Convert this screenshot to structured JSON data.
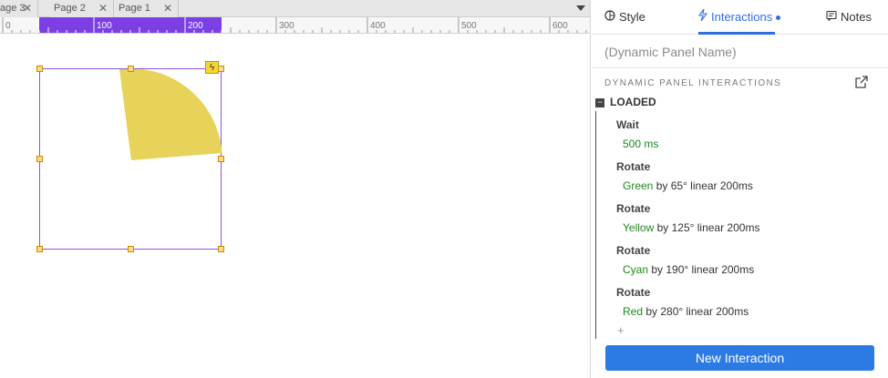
{
  "page_tabs": [
    {
      "label": "age 3",
      "close": "✕"
    },
    {
      "label": "Page 2",
      "close": "✕"
    },
    {
      "label": "Page 1",
      "close": "✕"
    }
  ],
  "ruler": {
    "labels": [
      "0",
      "100",
      "200",
      "300",
      "400",
      "500",
      "600"
    ],
    "selection_color": "#7b3fe4"
  },
  "canvas": {
    "shape_color": "#e8d35a",
    "panel_border_color": "#8d54d9",
    "lightning_glyph": "ϟ"
  },
  "inspector": {
    "tabs": [
      {
        "label": "Style",
        "icon": "style-icon"
      },
      {
        "label": "Interactions",
        "icon": "lightning-icon",
        "active": true
      },
      {
        "label": "Notes",
        "icon": "notes-icon"
      }
    ],
    "widget_name_placeholder": "(Dynamic Panel Name)",
    "section_heading": "DYNAMIC PANEL INTERACTIONS",
    "event": {
      "collapse_glyph": "−",
      "name": "LOADED"
    },
    "actions": [
      {
        "title": "Wait",
        "target": "500 ms",
        "detail": ""
      },
      {
        "title": "Rotate",
        "target": "Green",
        "detail": " by 65° linear 200ms"
      },
      {
        "title": "Rotate",
        "target": "Yellow",
        "detail": " by 125° linear 200ms"
      },
      {
        "title": "Rotate",
        "target": "Cyan",
        "detail": " by 190° linear 200ms"
      },
      {
        "title": "Rotate",
        "target": "Red",
        "detail": " by 280° linear 200ms"
      }
    ],
    "add_action_glyph": "+",
    "new_interaction_label": "New Interaction",
    "accent_color": "#2e6fe0"
  }
}
